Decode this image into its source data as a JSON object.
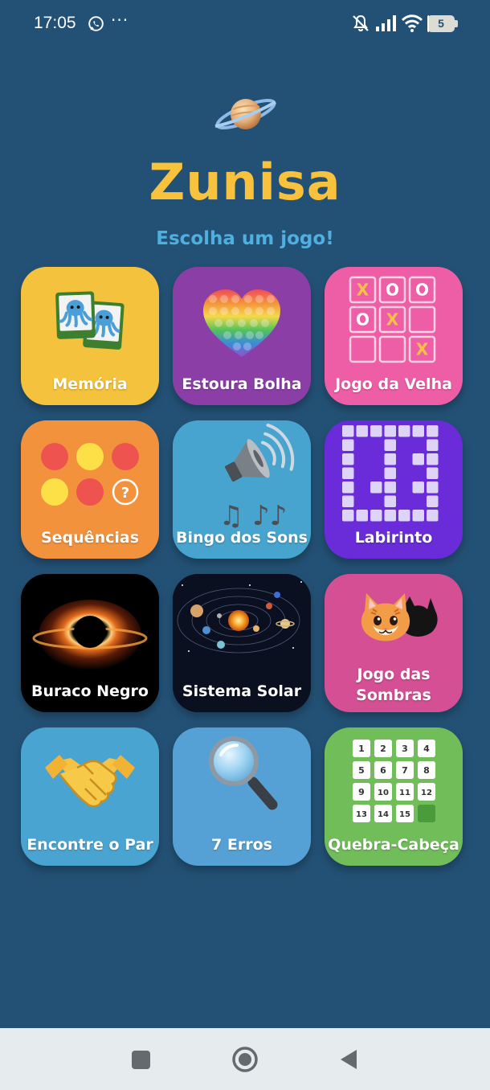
{
  "status_bar": {
    "time": "17:05",
    "overflow": "···",
    "battery_level": "5",
    "battery_fraction": 0.05,
    "icons": [
      "whatsapp-icon",
      "bell-off-icon",
      "signal-icon",
      "wifi-icon",
      "battery-icon"
    ]
  },
  "header": {
    "logo_icon": "planet-saturn-icon",
    "title": "Zunisa",
    "subtitle": "Escolha um jogo!"
  },
  "colors": {
    "background": "#235175",
    "title": "#f9c23c",
    "subtitle": "#4fb0e0"
  },
  "games": [
    {
      "label": "Memória",
      "color": "#f4c23c",
      "icon": "octopus-cards-icon"
    },
    {
      "label": "Estoura Bolha",
      "color": "#8b3fa6",
      "icon": "pop-it-heart-icon"
    },
    {
      "label": "Jogo da Velha",
      "color": "#ee5ea6",
      "icon": "tic-tac-toe-icon"
    },
    {
      "label": "Sequências",
      "color": "#f2923c",
      "icon": "color-dots-icon"
    },
    {
      "label": "Bingo dos Sons",
      "color": "#46a4ce",
      "icon": "speaker-music-icon"
    },
    {
      "label": "Labirinto",
      "color": "#6a2bd9",
      "icon": "maze-icon"
    },
    {
      "label": "Buraco Negro",
      "color": "#000000",
      "icon": "black-hole-icon"
    },
    {
      "label": "Sistema Solar",
      "color": "#000000",
      "icon": "solar-system-icon"
    },
    {
      "label": "Jogo das\nSombras",
      "color": "#d54f94",
      "icon": "cat-shadow-icon"
    },
    {
      "label": "Encontre o Par",
      "color": "#4aa4d1",
      "icon": "handshake-icon"
    },
    {
      "label": "7 Erros",
      "color": "#55a1d5",
      "icon": "magnifier-icon"
    },
    {
      "label": "Quebra-Cabeça",
      "color": "#71bd5a",
      "icon": "sliding-puzzle-icon"
    }
  ],
  "tic_tac_toe_marks": [
    "X",
    "O",
    "O",
    "O",
    "X",
    "",
    "",
    "",
    "X"
  ],
  "puzzle_tiles": [
    "1",
    "2",
    "3",
    "4",
    "5",
    "6",
    "7",
    "8",
    "9",
    "10",
    "11",
    "12",
    "13",
    "14",
    "15",
    ""
  ],
  "music_notes": "♫ ♪♪",
  "sequence_hint": "?",
  "navigation": {
    "buttons": [
      "recents-button",
      "home-button",
      "back-button"
    ]
  }
}
